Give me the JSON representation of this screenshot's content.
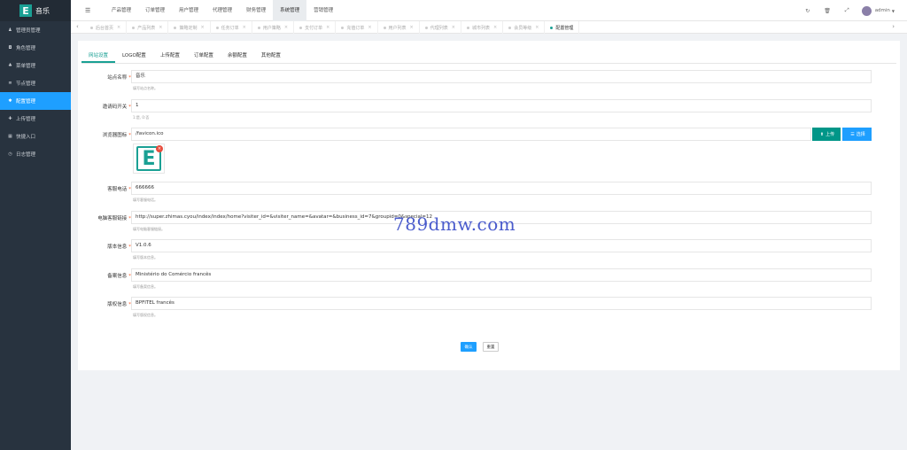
{
  "app": {
    "logo_letter": "E",
    "name": "音乐"
  },
  "sidebar": {
    "items": [
      {
        "label": "管理员管理",
        "icon": "user-icon",
        "glyph": "♟"
      },
      {
        "label": "角色管理",
        "icon": "id-card-icon",
        "glyph": "◘"
      },
      {
        "label": "菜单管理",
        "icon": "bell-icon",
        "glyph": "♣"
      },
      {
        "label": "节点管理",
        "icon": "list-icon",
        "glyph": "≣"
      },
      {
        "label": "配置管理",
        "icon": "gear-icon",
        "glyph": "✱"
      },
      {
        "label": "上传管理",
        "icon": "upload-icon",
        "glyph": "✚"
      },
      {
        "label": "快捷入口",
        "icon": "grid-icon",
        "glyph": "▦"
      },
      {
        "label": "日志管理",
        "icon": "clock-icon",
        "glyph": "◷"
      }
    ],
    "active_index": 4
  },
  "header": {
    "nav": [
      "产品管理",
      "订单管理",
      "用户管理",
      "代理管理",
      "财务管理",
      "系统管理",
      "营销管理"
    ],
    "active_nav": 5,
    "user": "admin"
  },
  "tabs": [
    {
      "label": "后台首页"
    },
    {
      "label": "产品列表"
    },
    {
      "label": "策略定制"
    },
    {
      "label": "任务订单"
    },
    {
      "label": "用户策略"
    },
    {
      "label": "支付订单"
    },
    {
      "label": "充值订单"
    },
    {
      "label": "用户列表"
    },
    {
      "label": "代理列表"
    },
    {
      "label": "城市列表"
    },
    {
      "label": "会员等级"
    },
    {
      "label": "配置管理"
    }
  ],
  "sub_tabs": [
    "网站设置",
    "LOGO配置",
    "上传配置",
    "订单配置",
    "余额配置",
    "其他配置"
  ],
  "form": {
    "site_name": {
      "label": "站点名称",
      "value": "音乐",
      "hint": "填写站点名称。"
    },
    "invite_switch": {
      "label": "邀请码开关",
      "value": "1",
      "hint": "1:是, 0:否"
    },
    "favicon": {
      "label": "浏览器图标",
      "value": "/favicon.ico",
      "upload_label": "上传",
      "select_label": "选择"
    },
    "service_phone": {
      "label": "客服电话",
      "value": "666666",
      "hint": "填写客服电话。"
    },
    "service_link": {
      "label": "电脑客服链接",
      "value": "http://super.zhimas.cyou/index/index/home?visiter_id=&visiter_name=&avatar=&business_id=7&groupid=0&special=12",
      "hint": "填写电脑客服链接。"
    },
    "version": {
      "label": "版本信息",
      "value": "V1.0.6",
      "hint": "填写版本信息。"
    },
    "record_info": {
      "label": "备案信息",
      "value": "Ministério do Comércio francês",
      "hint": "填写备案信息。"
    },
    "copyright": {
      "label": "版权信息",
      "value": "BPFITEL francês",
      "hint": "填写版权信息。"
    }
  },
  "actions": {
    "confirm": "确认",
    "reset": "重置"
  },
  "watermark": "789dmw.com"
}
